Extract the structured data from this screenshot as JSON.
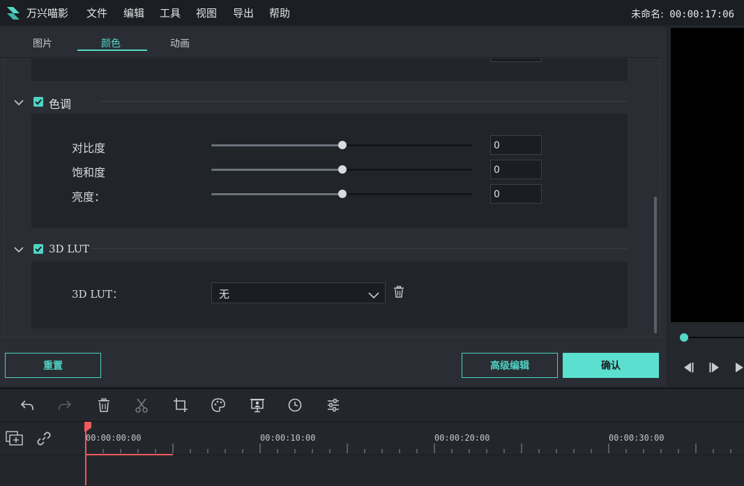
{
  "app": {
    "name": "万兴喵影",
    "menu": [
      "文件",
      "编辑",
      "工具",
      "视图",
      "导出",
      "帮助"
    ],
    "project_label": "未命名:",
    "project_time": "00:00:17:06"
  },
  "editor": {
    "tabs": [
      "图片",
      "颜色",
      "动画"
    ],
    "active_tab": "颜色",
    "tone": {
      "title": "色调",
      "checked": true,
      "params": [
        {
          "label": "对比度",
          "value": "0",
          "level": 0.5
        },
        {
          "label": "饱和度",
          "value": "0",
          "level": 0.5
        },
        {
          "label": "亮度：",
          "value": "0",
          "level": 0.5
        }
      ]
    },
    "lut": {
      "title": "3D LUT",
      "checked": true,
      "label": "3D LUT：",
      "selected": "无"
    },
    "buttons": {
      "reset": "重置",
      "advanced": "高级编辑",
      "confirm": "确认"
    }
  },
  "timeline": {
    "ruler": [
      "00:00:00:00",
      "00:00:10:00",
      "00:00:20:00",
      "00:00:30:00"
    ]
  },
  "colors": {
    "accent": "#56d8c8",
    "playhead": "#f05a5a"
  },
  "icons": [
    "logo-icon",
    "undo-icon",
    "redo-icon",
    "delete-icon",
    "cut-icon",
    "crop-icon",
    "color-icon",
    "greenscreen-icon",
    "speed-icon",
    "adjust-icon",
    "add-track-icon",
    "link-icon",
    "trash-icon",
    "chevron-down-icon",
    "check-icon",
    "step-back-icon",
    "step-forward-icon",
    "play-icon"
  ]
}
